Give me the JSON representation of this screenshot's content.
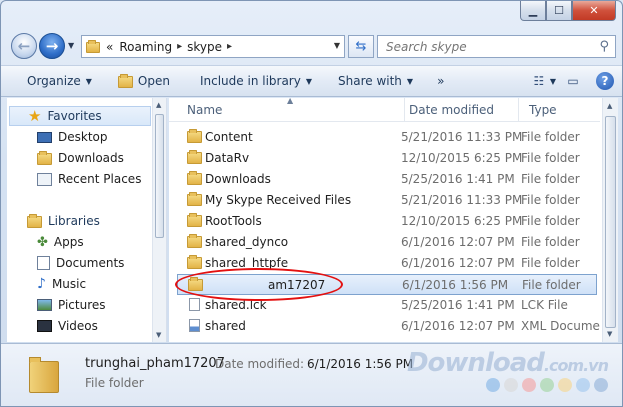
{
  "address": {
    "overflow": "«",
    "crumbs": [
      "Roaming",
      "skype"
    ]
  },
  "search": {
    "placeholder": "Search skype"
  },
  "toolbar": {
    "organize": "Organize",
    "open": "Open",
    "include_in_library": "Include in library",
    "share_with": "Share with",
    "more": "»"
  },
  "navpane": {
    "favorites_header": "Favorites",
    "favorites": [
      "Desktop",
      "Downloads",
      "Recent Places"
    ],
    "libraries_header": "Libraries",
    "libraries": [
      "Apps",
      "Documents",
      "Music",
      "Pictures",
      "Videos"
    ]
  },
  "columns": {
    "name": "Name",
    "date": "Date modified",
    "type": "Type"
  },
  "files": [
    {
      "name": "Content",
      "date": "5/21/2016 11:33 PM",
      "type": "File folder",
      "icon": "folder-icon"
    },
    {
      "name": "DataRv",
      "date": "12/10/2015 6:25 PM",
      "type": "File folder",
      "icon": "folder-icon"
    },
    {
      "name": "Downloads",
      "date": "5/25/2016 1:41 PM",
      "type": "File folder",
      "icon": "folder-icon"
    },
    {
      "name": "My Skype Received Files",
      "date": "5/21/2016 11:33 PM",
      "type": "File folder",
      "icon": "folder-icon"
    },
    {
      "name": "RootTools",
      "date": "12/10/2015 6:25 PM",
      "type": "File folder",
      "icon": "folder-icon"
    },
    {
      "name": "shared_dynco",
      "date": "6/1/2016 12:07 PM",
      "type": "File folder",
      "icon": "folder-icon"
    },
    {
      "name": "shared_httpfe",
      "date": "6/1/2016 12:07 PM",
      "type": "File folder",
      "icon": "folder-icon"
    },
    {
      "name": "am17207",
      "date": "6/1/2016 1:56 PM",
      "type": "File folder",
      "icon": "folder-icon",
      "selected": true
    },
    {
      "name": "shared.lck",
      "date": "5/25/2016 1:41 PM",
      "type": "LCK File",
      "icon": "file-icon"
    },
    {
      "name": "shared",
      "date": "6/1/2016 12:07 PM",
      "type": "XML Docume",
      "icon": "xml-icon"
    }
  ],
  "details": {
    "name": "trunghai_pham17207",
    "modified_label": "Date modified:",
    "modified_value": "6/1/2016 1:56 PM",
    "type": "File folder"
  },
  "watermark": {
    "main": "Download",
    "suffix": ".com.vn"
  },
  "colors": {
    "accent": "#2f6ec8",
    "highlight_oval": "#e31010",
    "selection": "#cfe1f7",
    "watermark_dots": [
      "#7fb2e6",
      "#d9d9d9",
      "#f3a0a0",
      "#9fd49f",
      "#f7d58a",
      "#9fc6ee",
      "#8fb0d8"
    ]
  }
}
